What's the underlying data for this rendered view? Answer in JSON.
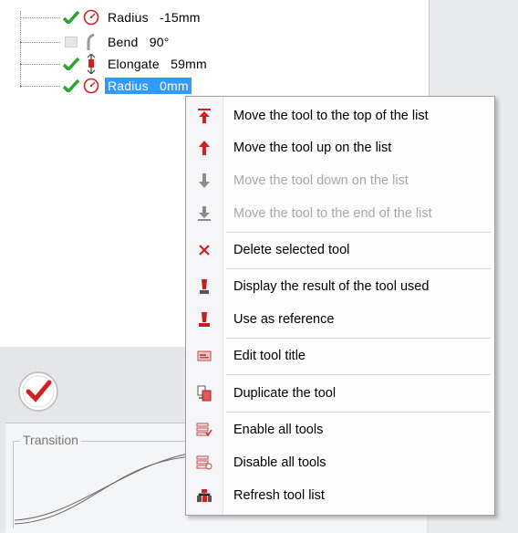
{
  "tree": {
    "items": [
      {
        "label": "Radius   -15mm",
        "checked": true,
        "icon": "radius-icon",
        "selected": false
      },
      {
        "label": "Bend   90°",
        "checked": false,
        "icon": "bend-icon",
        "selected": false
      },
      {
        "label": "Elongate   59mm",
        "checked": true,
        "icon": "elongate-icon",
        "selected": false
      },
      {
        "label": "Radius   0mm",
        "checked": true,
        "icon": "radius-icon",
        "selected": true
      }
    ]
  },
  "menu": {
    "items": [
      {
        "label": "Move the tool to the top of the list",
        "icon": "move-top-icon",
        "enabled": true
      },
      {
        "label": "Move the tool up on the list",
        "icon": "move-up-icon",
        "enabled": true
      },
      {
        "label": "Move the tool down on the list",
        "icon": "move-down-icon",
        "enabled": false
      },
      {
        "label": "Move the tool to the end of the list",
        "icon": "move-end-icon",
        "enabled": false
      },
      {
        "label": "Delete selected tool",
        "icon": "delete-icon",
        "enabled": true
      },
      {
        "label": "Display the result of the tool used",
        "icon": "display-result-icon",
        "enabled": true
      },
      {
        "label": "Use as reference",
        "icon": "reference-icon",
        "enabled": true
      },
      {
        "label": "Edit tool title",
        "icon": "edit-title-icon",
        "enabled": true
      },
      {
        "label": "Duplicate the tool",
        "icon": "duplicate-icon",
        "enabled": true
      },
      {
        "label": "Enable all tools",
        "icon": "enable-all-icon",
        "enabled": true
      },
      {
        "label": "Disable all tools",
        "icon": "disable-all-icon",
        "enabled": true
      },
      {
        "label": "Refresh tool list",
        "icon": "refresh-icon",
        "enabled": true
      }
    ]
  },
  "lower": {
    "transition_label": "Transition"
  },
  "colors": {
    "accent_red": "#d42020",
    "check_green": "#2aa52a",
    "selection_blue": "#3399ff",
    "disabled_text": "#a7a7a7"
  }
}
